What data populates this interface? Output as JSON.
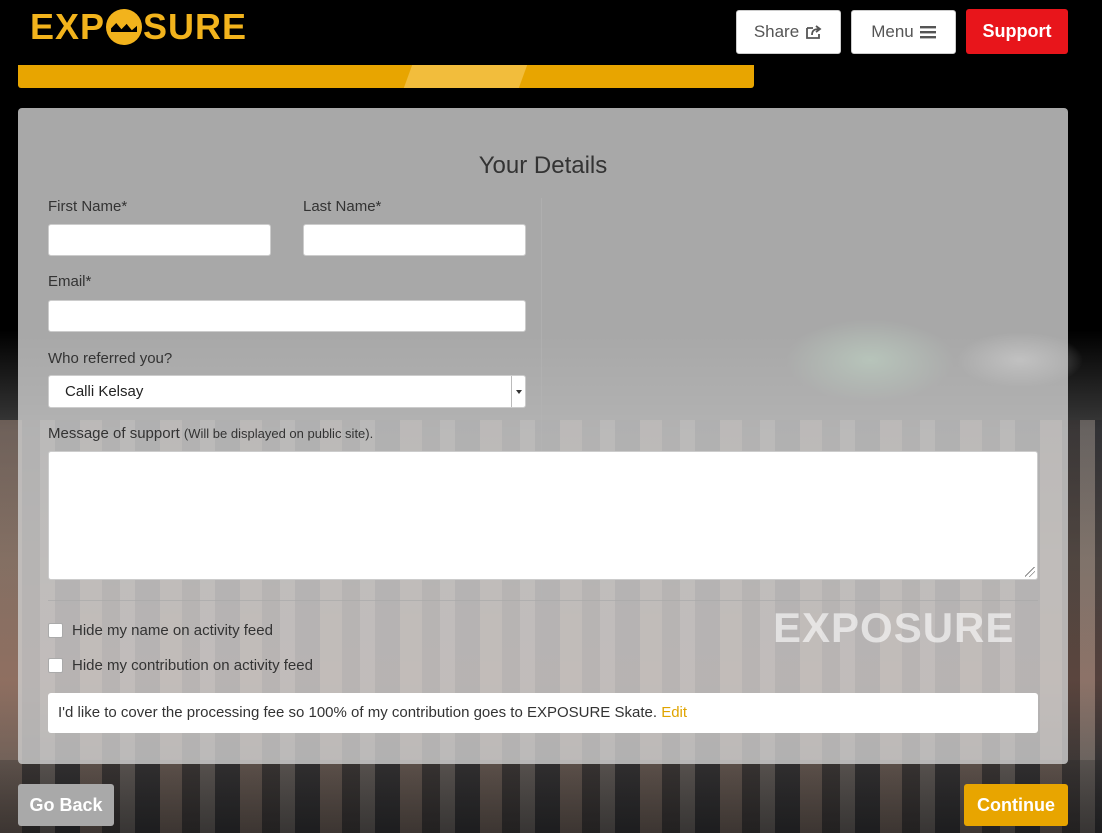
{
  "header": {
    "logo_text_left": "EXP",
    "logo_text_right": "SURE",
    "share_label": "Share",
    "menu_label": "Menu",
    "support_label": "Support"
  },
  "colors": {
    "brand_yellow": "#e8a500",
    "support_red": "#e8151b",
    "back_gray": "#a9a9a9"
  },
  "form": {
    "title": "Your Details",
    "first_name_label": "First Name*",
    "first_name_value": "",
    "last_name_label": "Last Name*",
    "last_name_value": "",
    "email_label": "Email*",
    "email_value": "",
    "referred_label": "Who referred you?",
    "referred_value": "Calli Kelsay",
    "message_label": "Message of support",
    "message_hint": "(Will be displayed on public site).",
    "message_value": "",
    "hide_name_label": "Hide my name on activity feed",
    "hide_name_checked": false,
    "hide_contribution_label": "Hide my contribution on activity feed",
    "hide_contribution_checked": false,
    "fee_text": "I'd like to cover the processing fee so 100% of my contribution goes to EXPOSURE Skate.",
    "fee_edit_label": "Edit"
  },
  "watermark": {
    "text": "EXPOSURE"
  },
  "footer": {
    "back_label": "Go Back",
    "continue_label": "Continue"
  },
  "icons": {
    "share": "share-icon",
    "menu": "hamburger-icon"
  }
}
